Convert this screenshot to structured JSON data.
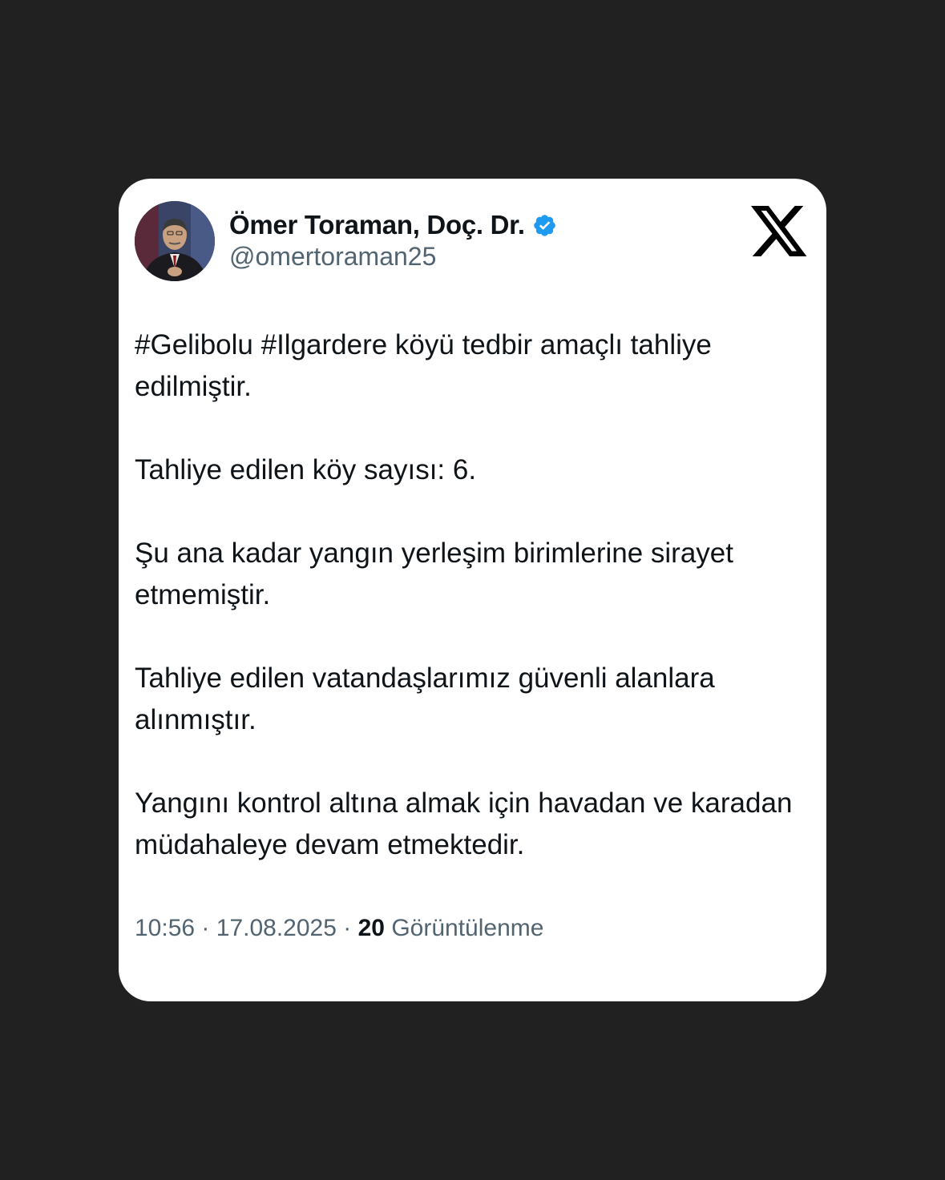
{
  "tweet": {
    "author": {
      "display_name": "Ömer Toraman, Doç. Dr.",
      "handle": "@omertoraman25",
      "verified": true,
      "verified_color": "#1d9bf0",
      "avatar": "profile-photo"
    },
    "platform_icon": "x-logo",
    "paragraphs": [
      "#Gelibolu #Ilgardere köyü tedbir amaçlı tahliye edilmiştir.",
      "Tahliye edilen köy sayısı: 6.",
      "Şu ana kadar yangın yerleşim birimlerine sirayet etmemiştir.",
      "Tahliye edilen vatandaşlarımız güvenli alanlara alınmıştır.",
      "Yangını kontrol altına almak için havadan ve karadan müdahaleye devam etmektedir."
    ],
    "time": "10:56",
    "date": "17.08.2025",
    "separator": "·",
    "views_count": "20",
    "views_label": "Görüntülenme"
  },
  "colors": {
    "background": "#212121",
    "card": "#ffffff",
    "text_primary": "#0f1419",
    "text_secondary": "#536471"
  }
}
